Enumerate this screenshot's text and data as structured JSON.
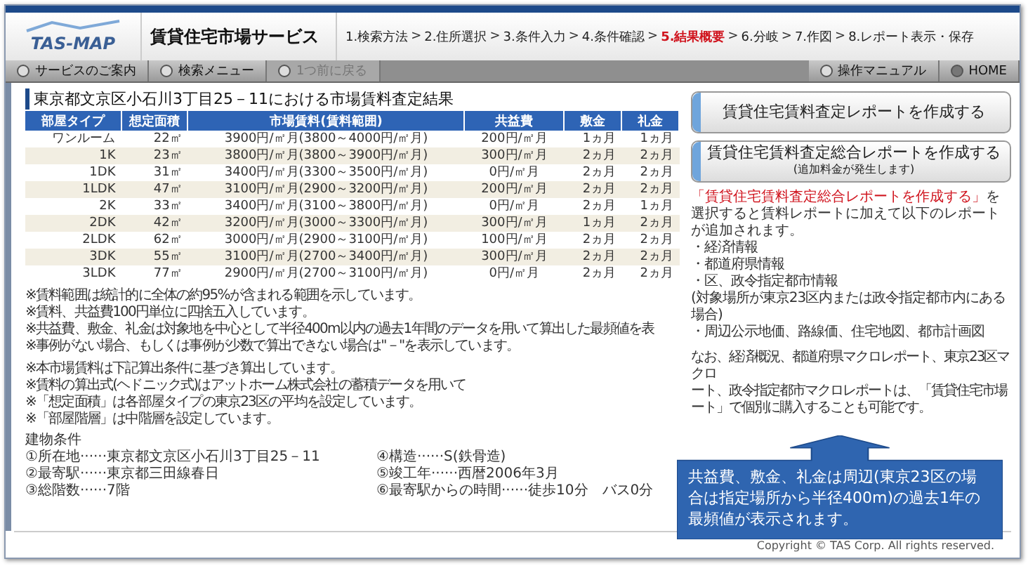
{
  "header": {
    "logo": "TAS-MAP",
    "title": "賃貸住宅市場サービス",
    "steps": [
      {
        "label": "1.検索方法",
        "selected": false
      },
      {
        "label": "2.住所選択",
        "selected": false
      },
      {
        "label": "3.条件入力",
        "selected": false
      },
      {
        "label": "4.条件確認",
        "selected": false
      },
      {
        "label": "5.結果概要",
        "selected": true
      },
      {
        "label": "6.分岐",
        "selected": false
      },
      {
        "label": "7.作図",
        "selected": false
      },
      {
        "label": "8.レポート表示・保存",
        "selected": false
      }
    ],
    "separator": ">"
  },
  "toolbar": {
    "left": [
      {
        "label": "サービスのご案内",
        "disabled": false
      },
      {
        "label": "検索メニュー",
        "disabled": false
      },
      {
        "label": "1つ前に戻る",
        "disabled": true
      }
    ],
    "right": [
      {
        "label": "操作マニュアル",
        "disabled": false,
        "kind": "circle"
      },
      {
        "label": "HOME",
        "disabled": false,
        "kind": "close"
      }
    ]
  },
  "result": {
    "title": "東京都文京区小石川3丁目25－11における市場賃料査定結果",
    "columns": [
      "部屋タイプ",
      "想定面積",
      "市場賃料(賃料範囲)",
      "共益費",
      "敷金",
      "礼金"
    ],
    "rows": [
      [
        "ワンルーム",
        "22㎡",
        "3900円/㎡月(3800～4000円/㎡月)",
        "200円/㎡月",
        "1ヵ月",
        "1ヵ月"
      ],
      [
        "1K",
        "23㎡",
        "3800円/㎡月(3800～3900円/㎡月)",
        "300円/㎡月",
        "2ヵ月",
        "2ヵ月"
      ],
      [
        "1DK",
        "31㎡",
        "3400円/㎡月(3300～3500円/㎡月)",
        "0円/㎡月",
        "2ヵ月",
        "2ヵ月"
      ],
      [
        "1LDK",
        "47㎡",
        "3100円/㎡月(2900～3200円/㎡月)",
        "200円/㎡月",
        "2ヵ月",
        "2ヵ月"
      ],
      [
        "2K",
        "33㎡",
        "3400円/㎡月(3100～3800円/㎡月)",
        "0円/㎡月",
        "2ヵ月",
        "1ヵ月"
      ],
      [
        "2DK",
        "42㎡",
        "3200円/㎡月(3000～3300円/㎡月)",
        "300円/㎡月",
        "1ヵ月",
        "2ヵ月"
      ],
      [
        "2LDK",
        "62㎡",
        "3000円/㎡月(2900～3100円/㎡月)",
        "100円/㎡月",
        "2ヵ月",
        "2ヵ月"
      ],
      [
        "3DK",
        "55㎡",
        "3100円/㎡月(2700～3400円/㎡月)",
        "300円/㎡月",
        "2ヵ月",
        "2ヵ月"
      ],
      [
        "3LDK",
        "77㎡",
        "2900円/㎡月(2700～3100円/㎡月)",
        "0円/㎡月",
        "2ヵ月",
        "2ヵ月"
      ]
    ]
  },
  "notes": [
    "※賃料範囲は統計的に全体の約95%が含まれる範囲を示しています。",
    "※賃料、共益費100円単位に四捨五入しています。",
    "※共益費、敷金、礼金は対象地を中心として半径400m以内の過去1年間のデータを用いて算出した最頻値を表",
    "※事例がない場合、もしくは事例が少数で算出できない場合は\"－\"を表示しています。"
  ],
  "notes2": [
    "※本市場賃料は下記算出条件に基づき算出しています。",
    "※賃料の算出式(ヘドニック式)はアットホーム株式会社の蓄積データを用いて",
    "※「想定面積」は各部屋タイプの東京23区の平均を設定しています。",
    "※「部屋階層」は中階層を設定しています。"
  ],
  "building": {
    "title": "建物条件",
    "items": [
      {
        "label": "①所在地",
        "value": "······東京都文京区小石川3丁目25－11"
      },
      {
        "label": "④構造",
        "value": "······S(鉄骨造)"
      },
      {
        "label": "②最寄駅",
        "value": "······東京都三田線春日"
      },
      {
        "label": "⑤竣工年",
        "value": "······西暦2006年3月"
      },
      {
        "label": "③総階数",
        "value": "······7階"
      },
      {
        "label": "⑥最寄駅からの時間",
        "value": "······徒歩10分　バス0分"
      }
    ]
  },
  "side": {
    "buttons": [
      {
        "label": "賃貸住宅賃料査定レポートを作成する"
      },
      {
        "label": "賃貸住宅賃料査定総合レポートを作成する",
        "sub": "(追加料金が発生します)"
      }
    ],
    "intro": "**「賃貸住宅賃料査定総合レポートを作成する」**を選択すると賃料レポートに加えて以下のレポートが追加されます。",
    "list": [
      "・経済情報",
      "・都道府県情報",
      "・区、政令指定都市情報",
      "(対象場所が東京23区内または政令指定都市内にある場合)",
      "・周辺公示地価、路線価、住宅地図、都市計画図"
    ],
    "more": [
      "なお、経済概況、都道府県マクロレポート、東京23区マクロ",
      "ート、政令指定都市マクロレポートは、「賃貸住宅市場",
      "ート」で個別に購入することも可能です。"
    ]
  },
  "callout": "共益費、敷金、礼金は周辺(東京23区の場合は指定場所から半径400m)の過去1年の最頻値が表示されます。",
  "copyright": "Copyright © TAS Corp. All rights reserved."
}
